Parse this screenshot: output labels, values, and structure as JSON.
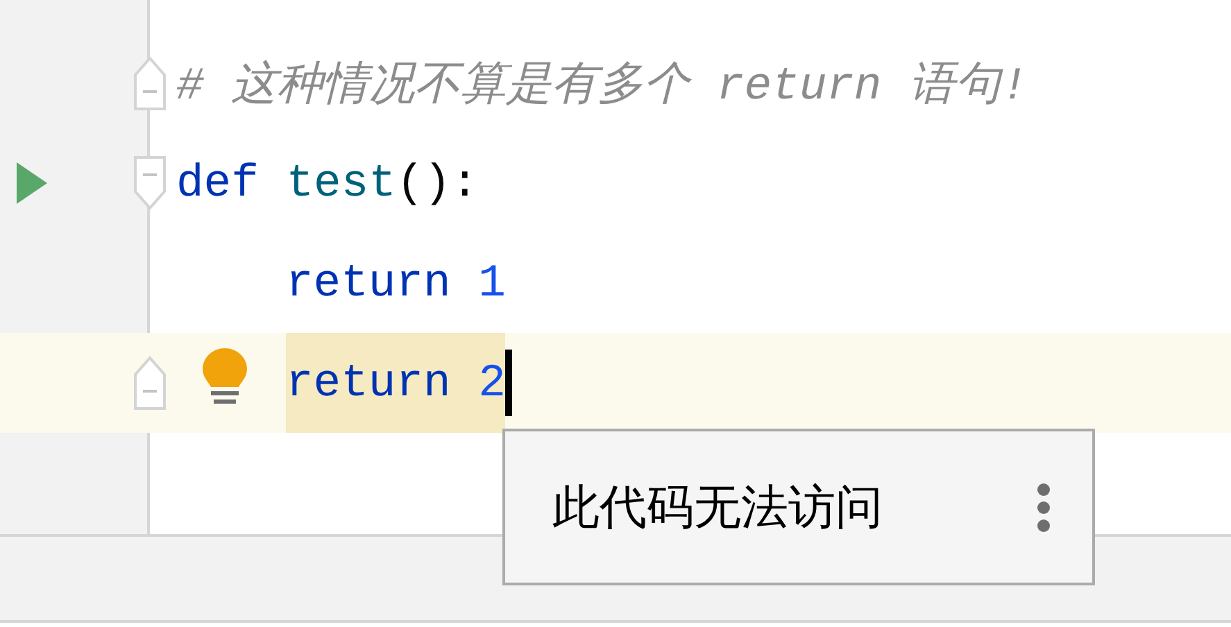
{
  "editor": {
    "lines": [
      {
        "fold_end": true,
        "current": false,
        "tokens": [
          {
            "kind": "comment",
            "text": "# 这种情况不算是有多个 return 语句!"
          }
        ]
      },
      {
        "run_button": true,
        "fold_start": true,
        "current": false,
        "tokens": [
          {
            "kind": "keyword",
            "text": "def"
          },
          {
            "kind": "function",
            "text": "test",
            "spaced": true
          },
          {
            "kind": "plain",
            "text": "():"
          }
        ]
      },
      {
        "indented": true,
        "current": false,
        "tokens": [
          {
            "kind": "keyword",
            "text": "return"
          },
          {
            "kind": "number",
            "text": "1",
            "spaced": true
          }
        ]
      },
      {
        "bulb": true,
        "fold_end": true,
        "indented": true,
        "current": true,
        "unreachable": true,
        "caret": true,
        "tokens": [
          {
            "kind": "keyword",
            "text": "return"
          },
          {
            "kind": "number",
            "text": "2",
            "spaced": true
          }
        ]
      }
    ]
  },
  "tooltip": {
    "message": "此代码无法访问"
  }
}
